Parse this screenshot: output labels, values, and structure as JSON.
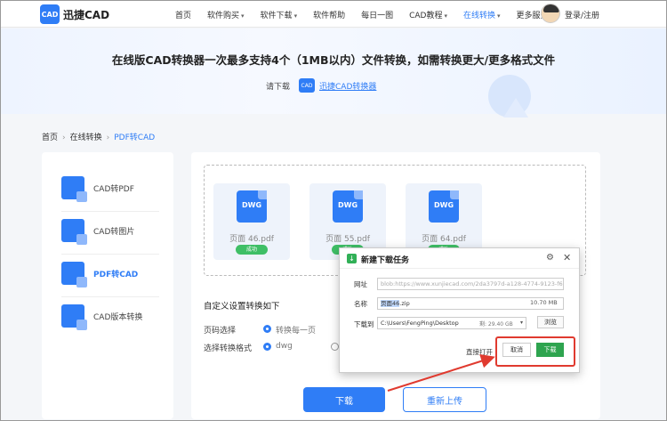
{
  "header": {
    "logo_text": "迅捷CAD",
    "logo_badge": "CAD",
    "nav": [
      {
        "label": "首页",
        "has_caret": false,
        "active": false
      },
      {
        "label": "软件购买",
        "has_caret": true,
        "active": false
      },
      {
        "label": "软件下载",
        "has_caret": true,
        "active": false
      },
      {
        "label": "软件帮助",
        "has_caret": false,
        "active": false
      },
      {
        "label": "每日一图",
        "has_caret": false,
        "active": false
      },
      {
        "label": "CAD教程",
        "has_caret": true,
        "active": false
      },
      {
        "label": "在线转换",
        "has_caret": true,
        "active": true
      },
      {
        "label": "更多服务",
        "has_caret": true,
        "active": false
      }
    ],
    "login_label": "登录/注册",
    "accent_color": "#2f7df6"
  },
  "banner": {
    "title": "在线版CAD转换器一次最多支持4个（1MB以内）文件转换，如需转换更大/更多格式文件",
    "prefix": "请下载",
    "mini_logo": "CAD",
    "link_label": "迅捷CAD转换器"
  },
  "breadcrumb": {
    "items": [
      "首页",
      "在线转换",
      "PDF转CAD"
    ],
    "separator": "›"
  },
  "sidebar": {
    "items": [
      {
        "label": "CAD转PDF",
        "icon": "cad-to-pdf-icon",
        "active": false
      },
      {
        "label": "CAD转图片",
        "icon": "cad-to-image-icon",
        "active": false
      },
      {
        "label": "PDF转CAD",
        "icon": "pdf-to-cad-icon",
        "active": true
      },
      {
        "label": "CAD版本转换",
        "icon": "cad-version-icon",
        "active": false
      }
    ]
  },
  "files": [
    {
      "type": "DWG",
      "name": "页面 46.pdf",
      "status": "成功"
    },
    {
      "type": "DWG",
      "name": "页面 55.pdf",
      "status": "成功"
    },
    {
      "type": "DWG",
      "name": "页面 64.pdf",
      "status": "成功"
    }
  ],
  "settings": {
    "title": "自定义设置转换如下",
    "page_label": "页码选择",
    "page_option": "转换每一页",
    "format_label": "选择转换格式",
    "format_option": "dwg"
  },
  "actions": {
    "download_label": "下载",
    "reupload_label": "重新上传"
  },
  "download_dialog": {
    "title": "新建下载任务",
    "url_label": "网址",
    "url_value": "blob:https://www.xunjiecad.com/2da3797d-a128-4774-9123-f6dace",
    "url_visible_domain": "www.xunjiecad.com",
    "name_label": "名称",
    "name_selected": "页面46",
    "name_ext": ".zip",
    "size": "10.70 MB",
    "save_label": "下载到",
    "save_path": "C:\\Users\\FengPing\\Desktop",
    "free_space": "剩: 29.40 GB",
    "browse_label": "浏览",
    "open_label": "直接打开",
    "cancel_label": "取消",
    "download_label": "下载",
    "highlight_color": "#e03a2f"
  }
}
